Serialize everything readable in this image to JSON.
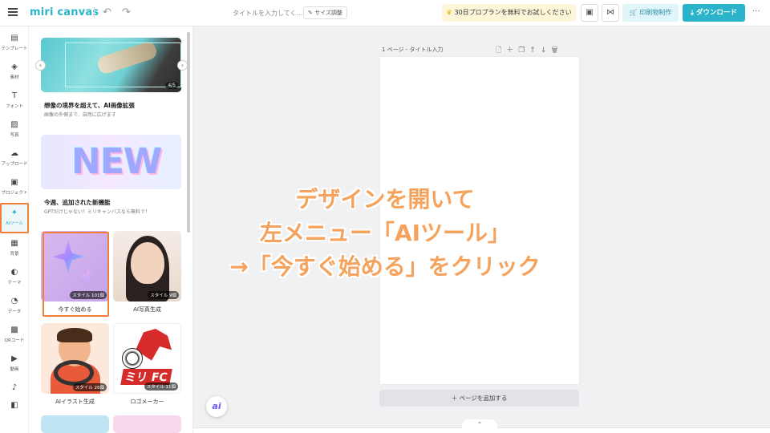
{
  "header": {
    "logo": "miri canvas",
    "undo_icon": "↶",
    "redo_icon": "↷",
    "doc_title": "タイトルを入力してく...",
    "resize_label": "サイズ調整",
    "trial_label": "30日プロプランを無料でお試しください",
    "print_label": "印刷物制作",
    "download_label": "ダウンロード",
    "more_label": "···"
  },
  "rail": {
    "items": [
      {
        "label": "テンプレート",
        "icon": "▤"
      },
      {
        "label": "素材",
        "icon": "◈"
      },
      {
        "label": "フォント",
        "icon": "T"
      },
      {
        "label": "写真",
        "icon": "▨"
      },
      {
        "label": "アップロード",
        "icon": "☁"
      },
      {
        "label": "プロジェクト",
        "icon": "▣"
      },
      {
        "label": "AIツール",
        "icon": "✦"
      },
      {
        "label": "背景",
        "icon": "▦"
      },
      {
        "label": "テーマ",
        "icon": "◐"
      },
      {
        "label": "データ",
        "icon": "◔"
      },
      {
        "label": "QRコード",
        "icon": "▩"
      },
      {
        "label": "動画",
        "icon": "▶"
      },
      {
        "label": "",
        "icon": "♪"
      },
      {
        "label": "",
        "icon": "◧"
      }
    ]
  },
  "panel": {
    "banner1": {
      "title": "想像の境界を超えて、AI画像拡張",
      "subtitle": "画像の外側まで、自然に広げます",
      "counter": "4/5"
    },
    "banner2": {
      "new_text": "NEW",
      "title": "今週、追加された新機能",
      "subtitle": "GPTだけじゃない！ミリキャンバスなら無料で！"
    },
    "tiles": [
      {
        "label": "今すぐ始める",
        "badge": "スタイル 101個"
      },
      {
        "label": "AI写真生成",
        "badge": "スタイル 9個"
      },
      {
        "label": "AIイラスト生成",
        "badge": "スタイル 26個"
      },
      {
        "label": "ロゴメーカー",
        "badge": "スタイル 11個",
        "logo_text": "ミリ FC"
      }
    ]
  },
  "canvas": {
    "page_label": "1 ページ - タイトル入力",
    "page_tools": "🗋＋❐↑↓🗑",
    "add_page_label": "＋ ページを追加する",
    "collapse_icon": "⌃"
  },
  "ai_button": "ai",
  "overlay": {
    "line1": "デザインを開いて",
    "line2": "左メニュー「AIツール」",
    "line3": "→「今すぐ始める」をクリック"
  }
}
